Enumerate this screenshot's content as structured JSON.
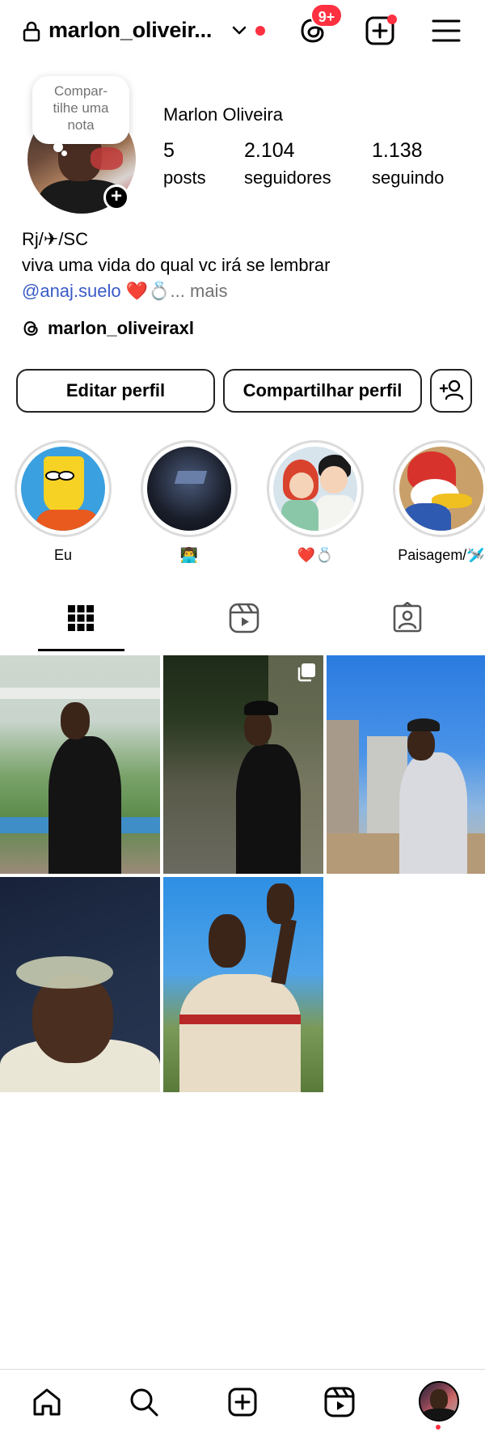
{
  "header": {
    "username": "marlon_oliveir...",
    "notification_badge": "9+",
    "accent_color": "#ff3040"
  },
  "profile": {
    "note_text": "Compar-\ntilhe uma\nnota",
    "full_name": "Marlon Oliveira",
    "stats": [
      {
        "value": "5",
        "label": "posts"
      },
      {
        "value": "2.104",
        "label": "seguidores"
      },
      {
        "value": "1.138",
        "label": "seguindo"
      }
    ],
    "bio_line1": "Rj/✈/SC",
    "bio_line2": "viva uma vida do qual vc irá se lembrar",
    "bio_mention": "@anaj.suelo",
    "bio_emojis": " ❤️💍",
    "bio_more": "... mais",
    "threads_handle": "marlon_oliveiraxl",
    "mention_color": "#3a5bc7"
  },
  "buttons": {
    "edit_profile": "Editar perfil",
    "share_profile": "Compartilhar perfil"
  },
  "highlights": [
    {
      "label": "Eu"
    },
    {
      "label": "👨‍💻"
    },
    {
      "label": "❤️💍"
    },
    {
      "label": "Paisagem/🛩️"
    }
  ],
  "tabs": [
    "grid-icon",
    "reels-icon",
    "tagged-icon"
  ],
  "bottom_nav": [
    "home-icon",
    "search-icon",
    "create-icon",
    "reels-icon",
    "profile-avatar"
  ]
}
